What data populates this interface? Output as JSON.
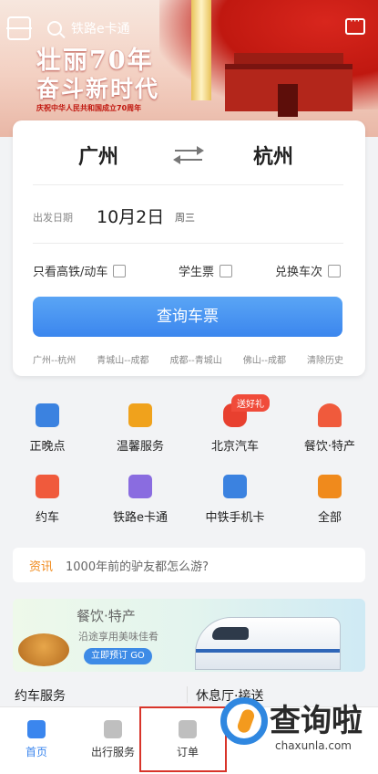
{
  "header": {
    "search_text": "铁路e卡通",
    "slogan_line1": "壮丽70年",
    "slogan_line2": "奋斗新时代",
    "slogan_sub": "庆祝中华人民共和国成立70周年"
  },
  "booking": {
    "from_city": "广州",
    "to_city": "杭州",
    "date_label": "出发日期",
    "date_value": "10月2日",
    "weekday": "周三",
    "options": [
      {
        "label": "只看高铁/动车",
        "checked": false
      },
      {
        "label": "学生票",
        "checked": false
      },
      {
        "label": "兑换车次",
        "checked": false
      }
    ],
    "search_button": "查询车票",
    "history": [
      "广州--杭州",
      "青城山--成都",
      "成都--青城山",
      "佛山--成都",
      "清除历史"
    ]
  },
  "services": [
    {
      "label": "正晚点",
      "icon": "train-icon",
      "color": "#3b82e0"
    },
    {
      "label": "温馨服务",
      "icon": "heart-icon",
      "color": "#f0a21c"
    },
    {
      "label": "北京汽车",
      "icon": "car-icon",
      "color": "#e8402f",
      "badge": "送好礼"
    },
    {
      "label": "餐饮·特产",
      "icon": "dining-icon",
      "color": "#f05a3c"
    },
    {
      "label": "约车",
      "icon": "taxi-icon",
      "color": "#f05a3c"
    },
    {
      "label": "铁路e卡通",
      "icon": "card-icon",
      "color": "#8a6ce0"
    },
    {
      "label": "中铁手机卡",
      "icon": "sim-card-icon",
      "color": "#3b82e0"
    },
    {
      "label": "全部",
      "icon": "grid-icon",
      "color": "#f08a1c"
    }
  ],
  "news": {
    "tag": "资讯",
    "text": "1000年前的驴友都怎么游?"
  },
  "promo": {
    "title": "餐饮·特产",
    "subtitle": "沿途享用美味佳肴",
    "button": "立即预订",
    "button_badge": "GO"
  },
  "sections": {
    "left": "约车服务",
    "right": "休息厅·接送"
  },
  "nav": [
    {
      "label": "首页",
      "active": true
    },
    {
      "label": "出行服务",
      "active": false
    },
    {
      "label": "订单",
      "active": false
    }
  ],
  "watermark": {
    "text": "查询啦",
    "domain": "chaxunla.com"
  }
}
